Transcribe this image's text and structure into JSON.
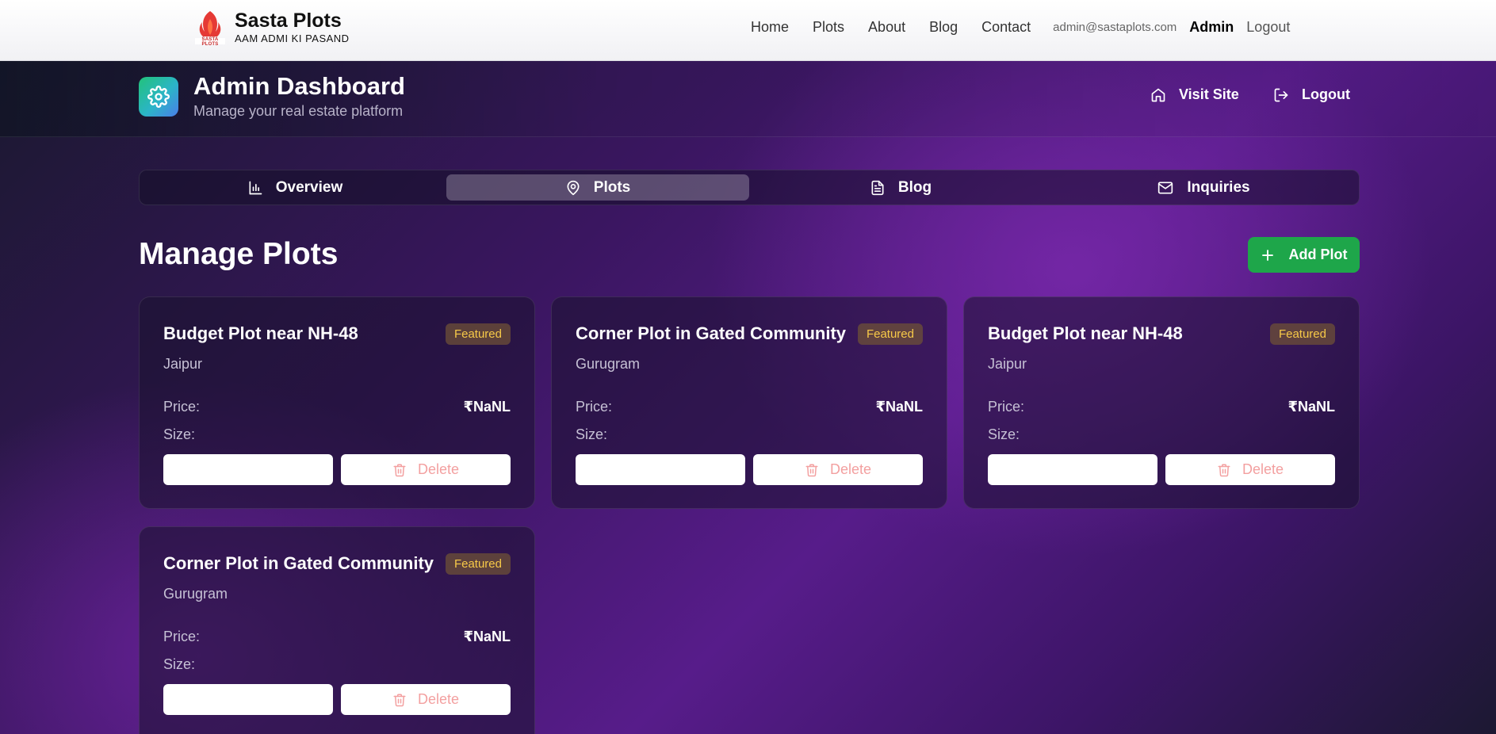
{
  "brand": {
    "name": "Sasta Plots",
    "tagline": "AAM ADMI KI PASAND",
    "logo_text": "SASTA PLOTS"
  },
  "nav": {
    "links": [
      "Home",
      "Plots",
      "About",
      "Blog",
      "Contact"
    ],
    "email": "admin@sastaplots.com",
    "admin": "Admin",
    "logout": "Logout"
  },
  "dashboard": {
    "title": "Admin Dashboard",
    "subtitle": "Manage your real estate platform",
    "visit_site": "Visit Site",
    "logout": "Logout"
  },
  "tabs": [
    {
      "label": "Overview",
      "icon": "bar-chart-icon"
    },
    {
      "label": "Plots",
      "icon": "map-pin-icon",
      "active": true
    },
    {
      "label": "Blog",
      "icon": "file-text-icon"
    },
    {
      "label": "Inquiries",
      "icon": "mail-icon"
    }
  ],
  "section": {
    "title": "Manage Plots",
    "add_button": "Add Plot"
  },
  "plots": [
    {
      "title": "Budget Plot near NH-48",
      "badge": "Featured",
      "location": "Jaipur",
      "price_label": "Price:",
      "price": "₹NaNL",
      "size_label": "Size:",
      "delete_label": "Delete"
    },
    {
      "title": "Corner Plot in Gated Community",
      "badge": "Featured",
      "location": "Gurugram",
      "price_label": "Price:",
      "price": "₹NaNL",
      "size_label": "Size:",
      "delete_label": "Delete"
    },
    {
      "title": "Budget Plot near NH-48",
      "badge": "Featured",
      "location": "Jaipur",
      "price_label": "Price:",
      "price": "₹NaNL",
      "size_label": "Size:",
      "delete_label": "Delete"
    },
    {
      "title": "Corner Plot in Gated Community",
      "badge": "Featured",
      "location": "Gurugram",
      "price_label": "Price:",
      "price": "₹NaNL",
      "size_label": "Size:",
      "delete_label": "Delete"
    }
  ],
  "colors": {
    "accent_green": "#1ea64a",
    "badge_text": "#f7c948",
    "delete_text": "#f3a0a0",
    "purple": "#571c8a"
  }
}
